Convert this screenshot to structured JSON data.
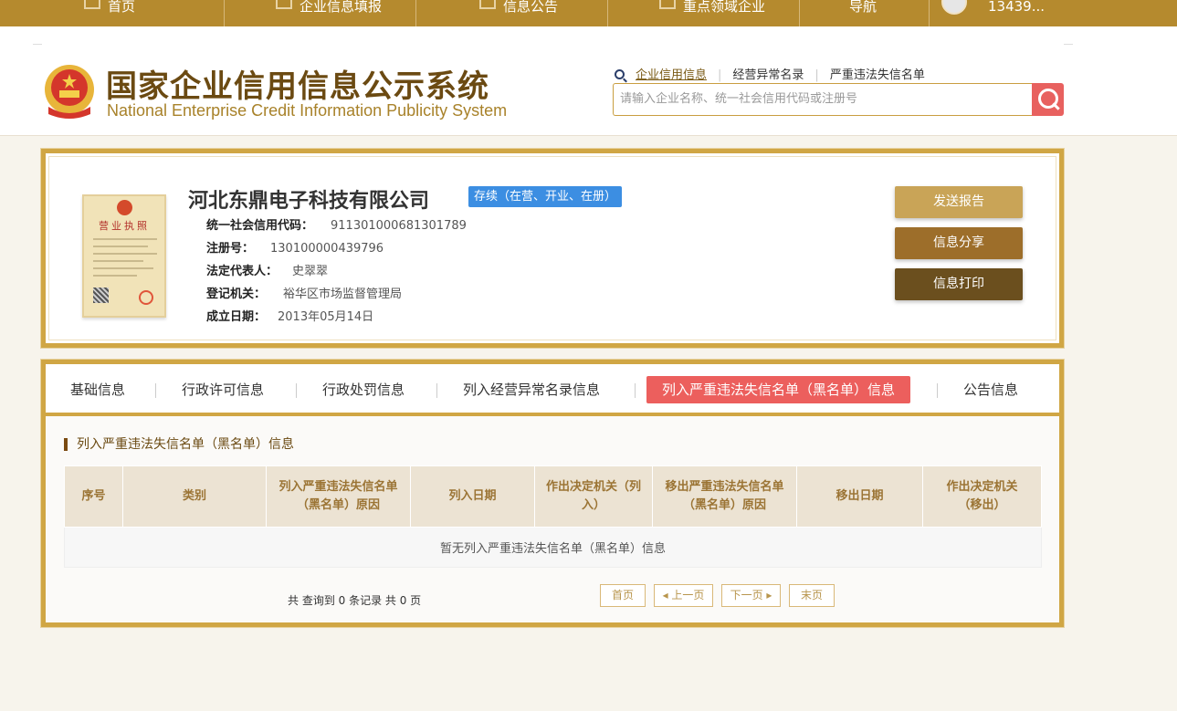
{
  "topnav": {
    "items": [
      {
        "label": "首页",
        "icon": "monitor-icon"
      },
      {
        "label": "企业信息填报",
        "icon": "pen-icon"
      },
      {
        "label": "信息公告",
        "icon": "document-icon"
      },
      {
        "label": "重点领域企业",
        "icon": "speaker-icon"
      },
      {
        "label": "导航"
      }
    ],
    "user": "13439..."
  },
  "header": {
    "title_cn": "国家企业信用信息公示系统",
    "title_en": "National Enterprise Credit Information Publicity System",
    "links": [
      "企业信用信息",
      "经营异常名录",
      "严重违法失信名单"
    ],
    "search_placeholder": "请输入企业名称、统一社会信用代码或注册号"
  },
  "company": {
    "name": "河北东鼎电子科技有限公司",
    "status": "存续（在营、开业、在册）",
    "license_title": "营业执照",
    "fields": [
      {
        "key": "统一社会信用代码：",
        "value": "911301000681301789"
      },
      {
        "key": "注册号：",
        "value": "130100000439796"
      },
      {
        "key": "法定代表人：",
        "value": "史翠翠"
      },
      {
        "key": "登记机关：",
        "value": "裕华区市场监督管理局"
      },
      {
        "key": "成立日期：",
        "value": "2013年05月14日"
      }
    ],
    "buttons": {
      "send": "发送报告",
      "share": "信息分享",
      "print": "信息打印"
    }
  },
  "tabs": [
    "基础信息",
    "行政许可信息",
    "行政处罚信息",
    "列入经营异常名录信息",
    "列入严重违法失信名单（黑名单）信息",
    "公告信息"
  ],
  "active_tab": 4,
  "section": {
    "title": "列入严重违法失信名单（黑名单）信息",
    "columns": [
      "序号",
      "类别",
      "列入严重违法失信名单（黑名单）原因",
      "列入日期",
      "作出决定机关（列入）",
      "移出严重违法失信名单（黑名单）原因",
      "移出日期",
      "作出决定机关（移出）"
    ],
    "empty_text": "暂无列入严重违法失信名单（黑名单）信息"
  },
  "pager": {
    "summary": "共 查询到 0 条记录 共 0 页",
    "first": "首页",
    "prev": "上一页",
    "next": "下一页",
    "last": "末页"
  },
  "colors": {
    "brand_gold": "#b58a2e",
    "frame_gold": "#d0a644",
    "active_tab": "#ec5f5d",
    "status_blue": "#3c8ee2",
    "title_brown": "#6b4a12"
  }
}
